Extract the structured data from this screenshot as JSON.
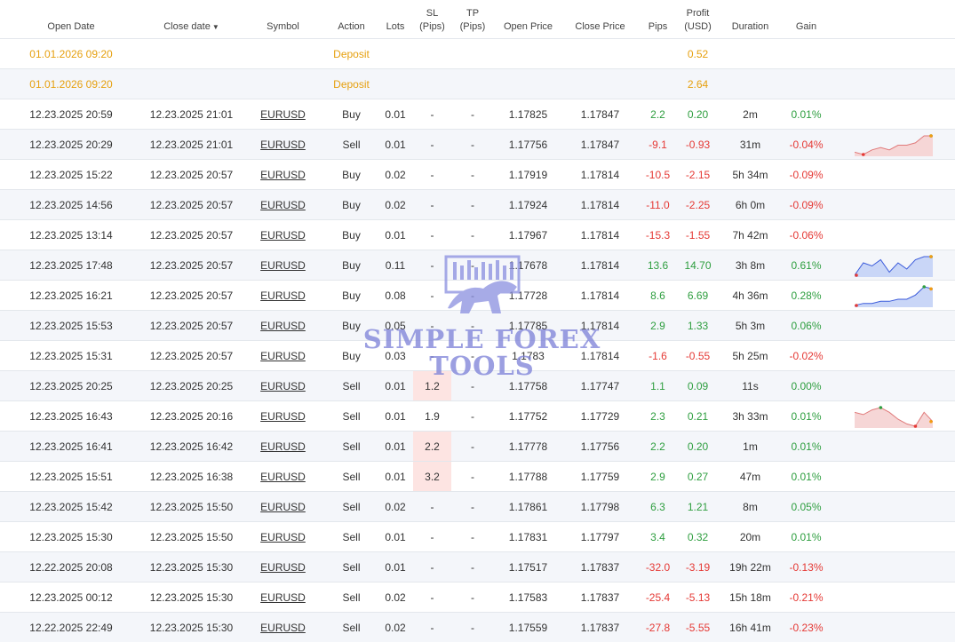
{
  "columns": [
    "Open Date",
    "Close date",
    "Symbol",
    "Action",
    "Lots",
    "SL\n(Pips)",
    "TP\n(Pips)",
    "Open Price",
    "Close Price",
    "Pips",
    "Profit\n(USD)",
    "Duration",
    "Gain",
    ""
  ],
  "header": {
    "open_date": "Open Date",
    "close_date": "Close date",
    "sort_indicator": "▼",
    "symbol": "Symbol",
    "action": "Action",
    "lots": "Lots",
    "sl_line1": "SL",
    "sl_line2": "(Pips)",
    "tp_line1": "TP",
    "tp_line2": "(Pips)",
    "open_price": "Open Price",
    "close_price": "Close Price",
    "pips": "Pips",
    "profit_line1": "Profit",
    "profit_line2": "(USD)",
    "duration": "Duration",
    "gain": "Gain"
  },
  "rows": [
    {
      "open": "01.01.2026 09:20",
      "close": "",
      "symbol": "",
      "action": "Deposit",
      "lots": "",
      "sl": "",
      "tp": "",
      "open_price": "",
      "close_price": "",
      "pips": "",
      "profit": "0.52",
      "duration": "",
      "gain": "",
      "type": "deposit"
    },
    {
      "open": "01.01.2026 09:20",
      "close": "",
      "symbol": "",
      "action": "Deposit",
      "lots": "",
      "sl": "",
      "tp": "",
      "open_price": "",
      "close_price": "",
      "pips": "",
      "profit": "2.64",
      "duration": "",
      "gain": "",
      "type": "deposit"
    },
    {
      "open": "12.23.2025 20:59",
      "close": "12.23.2025 21:01",
      "symbol": "EURUSD",
      "action": "Buy",
      "lots": "0.01",
      "sl": "-",
      "tp": "-",
      "open_price": "1.17825",
      "close_price": "1.17847",
      "pips": "2.2",
      "profit": "0.20",
      "duration": "2m",
      "gain": "0.01%",
      "type": "trade"
    },
    {
      "open": "12.23.2025 20:29",
      "close": "12.23.2025 21:01",
      "symbol": "EURUSD",
      "action": "Sell",
      "lots": "0.01",
      "sl": "-",
      "tp": "-",
      "open_price": "1.17756",
      "close_price": "1.17847",
      "pips": "-9.1",
      "profit": "-0.93",
      "duration": "31m",
      "gain": "-0.04%",
      "type": "trade"
    },
    {
      "open": "12.23.2025 15:22",
      "close": "12.23.2025 20:57",
      "symbol": "EURUSD",
      "action": "Buy",
      "lots": "0.02",
      "sl": "-",
      "tp": "-",
      "open_price": "1.17919",
      "close_price": "1.17814",
      "pips": "-10.5",
      "profit": "-2.15",
      "duration": "5h 34m",
      "gain": "-0.09%",
      "type": "trade"
    },
    {
      "open": "12.23.2025 14:56",
      "close": "12.23.2025 20:57",
      "symbol": "EURUSD",
      "action": "Buy",
      "lots": "0.02",
      "sl": "-",
      "tp": "-",
      "open_price": "1.17924",
      "close_price": "1.17814",
      "pips": "-11.0",
      "profit": "-2.25",
      "duration": "6h 0m",
      "gain": "-0.09%",
      "type": "trade"
    },
    {
      "open": "12.23.2025 13:14",
      "close": "12.23.2025 20:57",
      "symbol": "EURUSD",
      "action": "Buy",
      "lots": "0.01",
      "sl": "-",
      "tp": "-",
      "open_price": "1.17967",
      "close_price": "1.17814",
      "pips": "-15.3",
      "profit": "-1.55",
      "duration": "7h 42m",
      "gain": "-0.06%",
      "type": "trade"
    },
    {
      "open": "12.23.2025 17:48",
      "close": "12.23.2025 20:57",
      "symbol": "EURUSD",
      "action": "Buy",
      "lots": "0.11",
      "sl": "-",
      "tp": "-",
      "open_price": "1.17678",
      "close_price": "1.17814",
      "pips": "13.6",
      "profit": "14.70",
      "duration": "3h 8m",
      "gain": "0.61%",
      "type": "trade"
    },
    {
      "open": "12.23.2025 16:21",
      "close": "12.23.2025 20:57",
      "symbol": "EURUSD",
      "action": "Buy",
      "lots": "0.08",
      "sl": "-",
      "tp": "-",
      "open_price": "1.17728",
      "close_price": "1.17814",
      "pips": "8.6",
      "profit": "6.69",
      "duration": "4h 36m",
      "gain": "0.28%",
      "type": "trade"
    },
    {
      "open": "12.23.2025 15:53",
      "close": "12.23.2025 20:57",
      "symbol": "EURUSD",
      "action": "Buy",
      "lots": "0.05",
      "sl": "-",
      "tp": "-",
      "open_price": "1.17785",
      "close_price": "1.17814",
      "pips": "2.9",
      "profit": "1.33",
      "duration": "5h 3m",
      "gain": "0.06%",
      "type": "trade"
    },
    {
      "open": "12.23.2025 15:31",
      "close": "12.23.2025 20:57",
      "symbol": "EURUSD",
      "action": "Buy",
      "lots": "0.03",
      "sl": "-",
      "tp": "-",
      "open_price": "1.1783",
      "close_price": "1.17814",
      "pips": "-1.6",
      "profit": "-0.55",
      "duration": "5h 25m",
      "gain": "-0.02%",
      "type": "trade"
    },
    {
      "open": "12.23.2025 20:25",
      "close": "12.23.2025 20:25",
      "symbol": "EURUSD",
      "action": "Sell",
      "lots": "0.01",
      "sl": "1.2",
      "tp": "-",
      "open_price": "1.17758",
      "close_price": "1.17747",
      "pips": "1.1",
      "profit": "0.09",
      "duration": "11s",
      "gain": "0.00%",
      "type": "trade",
      "sl_hl": true
    },
    {
      "open": "12.23.2025 16:43",
      "close": "12.23.2025 20:16",
      "symbol": "EURUSD",
      "action": "Sell",
      "lots": "0.01",
      "sl": "1.9",
      "tp": "-",
      "open_price": "1.17752",
      "close_price": "1.17729",
      "pips": "2.3",
      "profit": "0.21",
      "duration": "3h 33m",
      "gain": "0.01%",
      "type": "trade"
    },
    {
      "open": "12.23.2025 16:41",
      "close": "12.23.2025 16:42",
      "symbol": "EURUSD",
      "action": "Sell",
      "lots": "0.01",
      "sl": "2.2",
      "tp": "-",
      "open_price": "1.17778",
      "close_price": "1.17756",
      "pips": "2.2",
      "profit": "0.20",
      "duration": "1m",
      "gain": "0.01%",
      "type": "trade",
      "sl_hl": true
    },
    {
      "open": "12.23.2025 15:51",
      "close": "12.23.2025 16:38",
      "symbol": "EURUSD",
      "action": "Sell",
      "lots": "0.01",
      "sl": "3.2",
      "tp": "-",
      "open_price": "1.17788",
      "close_price": "1.17759",
      "pips": "2.9",
      "profit": "0.27",
      "duration": "47m",
      "gain": "0.01%",
      "type": "trade",
      "sl_hl": true
    },
    {
      "open": "12.23.2025 15:42",
      "close": "12.23.2025 15:50",
      "symbol": "EURUSD",
      "action": "Sell",
      "lots": "0.02",
      "sl": "-",
      "tp": "-",
      "open_price": "1.17861",
      "close_price": "1.17798",
      "pips": "6.3",
      "profit": "1.21",
      "duration": "8m",
      "gain": "0.05%",
      "type": "trade"
    },
    {
      "open": "12.23.2025 15:30",
      "close": "12.23.2025 15:50",
      "symbol": "EURUSD",
      "action": "Sell",
      "lots": "0.01",
      "sl": "-",
      "tp": "-",
      "open_price": "1.17831",
      "close_price": "1.17797",
      "pips": "3.4",
      "profit": "0.32",
      "duration": "20m",
      "gain": "0.01%",
      "type": "trade"
    },
    {
      "open": "12.22.2025 20:08",
      "close": "12.23.2025 15:30",
      "symbol": "EURUSD",
      "action": "Sell",
      "lots": "0.01",
      "sl": "-",
      "tp": "-",
      "open_price": "1.17517",
      "close_price": "1.17837",
      "pips": "-32.0",
      "profit": "-3.19",
      "duration": "19h 22m",
      "gain": "-0.13%",
      "type": "trade"
    },
    {
      "open": "12.23.2025 00:12",
      "close": "12.23.2025 15:30",
      "symbol": "EURUSD",
      "action": "Sell",
      "lots": "0.02",
      "sl": "-",
      "tp": "-",
      "open_price": "1.17583",
      "close_price": "1.17837",
      "pips": "-25.4",
      "profit": "-5.13",
      "duration": "15h 18m",
      "gain": "-0.21%",
      "type": "trade"
    },
    {
      "open": "12.22.2025 22:49",
      "close": "12.23.2025 15:30",
      "symbol": "EURUSD",
      "action": "Sell",
      "lots": "0.02",
      "sl": "-",
      "tp": "-",
      "open_price": "1.17559",
      "close_price": "1.17837",
      "pips": "-27.8",
      "profit": "-5.55",
      "duration": "16h 41m",
      "gain": "-0.23%",
      "type": "trade"
    }
  ],
  "sparklines": {
    "3": {
      "color": "#e07a7a",
      "fill": "#f6d6d6",
      "values": [
        2,
        1,
        3,
        4,
        3,
        5,
        5,
        6,
        9,
        9
      ]
    },
    "7": {
      "color": "#3b5bdb",
      "fill": "#c9d6f7",
      "values": [
        3,
        7,
        6,
        8,
        4,
        7,
        5,
        8,
        9,
        9
      ]
    },
    "8": {
      "color": "#3b5bdb",
      "fill": "#c9d6f7",
      "values": [
        0,
        1,
        1,
        2,
        2,
        3,
        3,
        5,
        9,
        8
      ]
    },
    "12": {
      "color": "#e07a7a",
      "fill": "#f6d6d6",
      "values": [
        7,
        6,
        8,
        9,
        7,
        4,
        2,
        1,
        7,
        3
      ]
    }
  },
  "watermark": {
    "line1": "SIMPLE FOREX",
    "line2": "TOOLS"
  },
  "colors": {
    "positive": "#2e9e3f",
    "negative": "#e53935",
    "deposit": "#e6a00f"
  }
}
